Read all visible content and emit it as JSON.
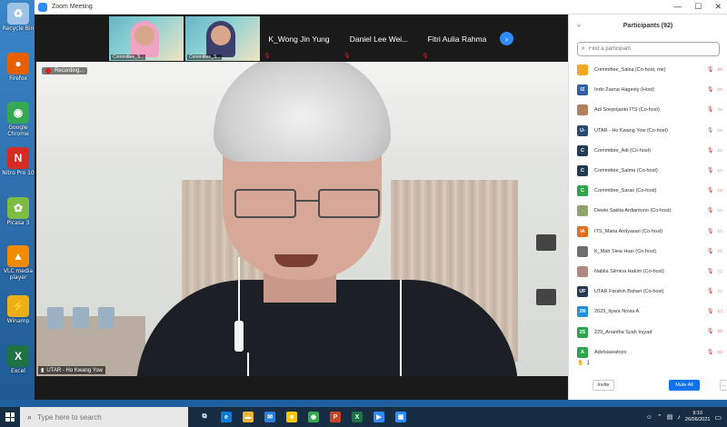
{
  "desktop": {
    "icons": [
      {
        "label": "Recycle Bin",
        "icon": "recycle-bin-icon",
        "color": "#9ec3e6",
        "glyph": "♻"
      },
      {
        "label": "Firefox",
        "icon": "firefox-icon",
        "color": "#e66000",
        "glyph": "●"
      },
      {
        "label": "Google Chrome",
        "icon": "chrome-icon",
        "color": "#34a853",
        "glyph": "◉"
      },
      {
        "label": "Nitro Pro 10",
        "icon": "nitro-pro-icon",
        "color": "#d42b22",
        "glyph": "N"
      },
      {
        "label": "Picasa 3",
        "icon": "picasa-icon",
        "color": "#7dbb42",
        "glyph": "✿"
      },
      {
        "label": "VLC media player",
        "icon": "vlc-icon",
        "color": "#f08a00",
        "glyph": "▲"
      },
      {
        "label": "Winamp",
        "icon": "winamp-icon",
        "color": "#ecaf18",
        "glyph": "⚡"
      },
      {
        "label": "Excel",
        "icon": "excel-icon",
        "color": "#1f7244",
        "glyph": "X"
      }
    ]
  },
  "window": {
    "title": "Zoom Meeting",
    "min": "—",
    "max": "☐",
    "close": "✕"
  },
  "gallery": {
    "tiles": [
      {
        "name": "Committee_S...",
        "type": "video",
        "hijab": "#f0a3c3"
      },
      {
        "name": "Committee_S...",
        "type": "video",
        "hijab": "#3b3f6b"
      },
      {
        "name": "K_Wong Jin Yung",
        "type": "name"
      },
      {
        "name": "Daniel  Lee  Wei...",
        "type": "name"
      },
      {
        "name": "Fitri Aulia Rahma",
        "type": "name"
      }
    ],
    "next_icon": "›"
  },
  "main_video": {
    "recording_label": "Recording...",
    "speaker_name": "UTAR - Ho Kwang Yow"
  },
  "participants": {
    "title": "Participants (92)",
    "search_placeholder": "Find a participant",
    "reaction": "1",
    "invite_label": "Invite",
    "mute_all_label": "Mute All",
    "more_label": "...",
    "list": [
      {
        "initials": "",
        "name": "Committee_Salsa (Co-host, me)",
        "color": "#f5a623",
        "mic_on": false,
        "cam_on": false
      },
      {
        "initials": "IZ",
        "name": "Indri Zaena Hagesty (Host)",
        "color": "#2f5fa6",
        "mic_on": false,
        "cam_on": false
      },
      {
        "initials": "",
        "name": "Adi Soeprijanto ITS (Co-host)",
        "color": "#b08060",
        "mic_on": false,
        "cam_on": true
      },
      {
        "initials": "U-",
        "name": "UTAR - Ho Kwang Yow (Co-host)",
        "color": "#2a4a6f",
        "mic_on": true,
        "cam_on": true
      },
      {
        "initials": "C",
        "name": "Committee_Adi (Co-host)",
        "color": "#253b52",
        "mic_on": false,
        "cam_on": true
      },
      {
        "initials": "C",
        "name": "Committee_Salma (Co-host)",
        "color": "#253b52",
        "mic_on": false,
        "cam_on": true
      },
      {
        "initials": "C",
        "name": "Committee_Saras (Co-host)",
        "color": "#2ea44f",
        "mic_on": false,
        "cam_on": false
      },
      {
        "initials": "",
        "name": "Dewie Saktia Ardiantono (Co-host)",
        "color": "#8fa270",
        "mic_on": false,
        "cam_on": true
      },
      {
        "initials": "IA",
        "name": "ITS_Maria Anityasari (Co-host)",
        "color": "#e0701e",
        "mic_on": false,
        "cam_on": true
      },
      {
        "initials": "",
        "name": "K_Mah Siew Huei (Co-host)",
        "color": "#6f6f6f",
        "mic_on": false,
        "cam_on": true
      },
      {
        "initials": "",
        "name": "Nabila Silmina Hakim (Co-host)",
        "color": "#b08a80",
        "mic_on": false,
        "cam_on": true
      },
      {
        "initials": "UF",
        "name": "UTAR Farahin Bahari (Co-host)",
        "color": "#253b52",
        "mic_on": false,
        "cam_on": true
      },
      {
        "initials": "2N",
        "name": "2029_Ilyara Novia A.",
        "color": "#1f8fd8",
        "mic_on": false,
        "cam_on": false
      },
      {
        "initials": "2S",
        "name": "229_Anantha Syah Irsyad",
        "color": "#2ea44f",
        "mic_on": false,
        "cam_on": false
      },
      {
        "initials": "A",
        "name": "Adelsiawatoyo",
        "color": "#2ea44f",
        "mic_on": false,
        "cam_on": false
      }
    ]
  },
  "taskbar": {
    "search_placeholder": "Type here to search",
    "apps": [
      {
        "icon": "task-view-icon",
        "color": "#162d43",
        "glyph": "⧉"
      },
      {
        "icon": "edge-icon",
        "color": "#0f7bd8",
        "glyph": "e"
      },
      {
        "icon": "file-explorer-icon",
        "color": "#e8b43a",
        "glyph": "▬"
      },
      {
        "icon": "mail-icon",
        "color": "#2a7fd8",
        "glyph": "✉"
      },
      {
        "icon": "sticky-notes-icon",
        "color": "#f4c700",
        "glyph": "■"
      },
      {
        "icon": "chrome-icon",
        "color": "#34a853",
        "glyph": "◉"
      },
      {
        "icon": "powerpoint-icon",
        "color": "#c94324",
        "glyph": "P"
      },
      {
        "icon": "excel-icon",
        "color": "#1f7244",
        "glyph": "X"
      },
      {
        "icon": "zoom-icon",
        "color": "#2d8cff",
        "glyph": "▶"
      },
      {
        "icon": "zoom-meeting-icon",
        "color": "#2d8cff",
        "glyph": "▣"
      }
    ],
    "time": "9:10",
    "date": "26/06/2021"
  }
}
